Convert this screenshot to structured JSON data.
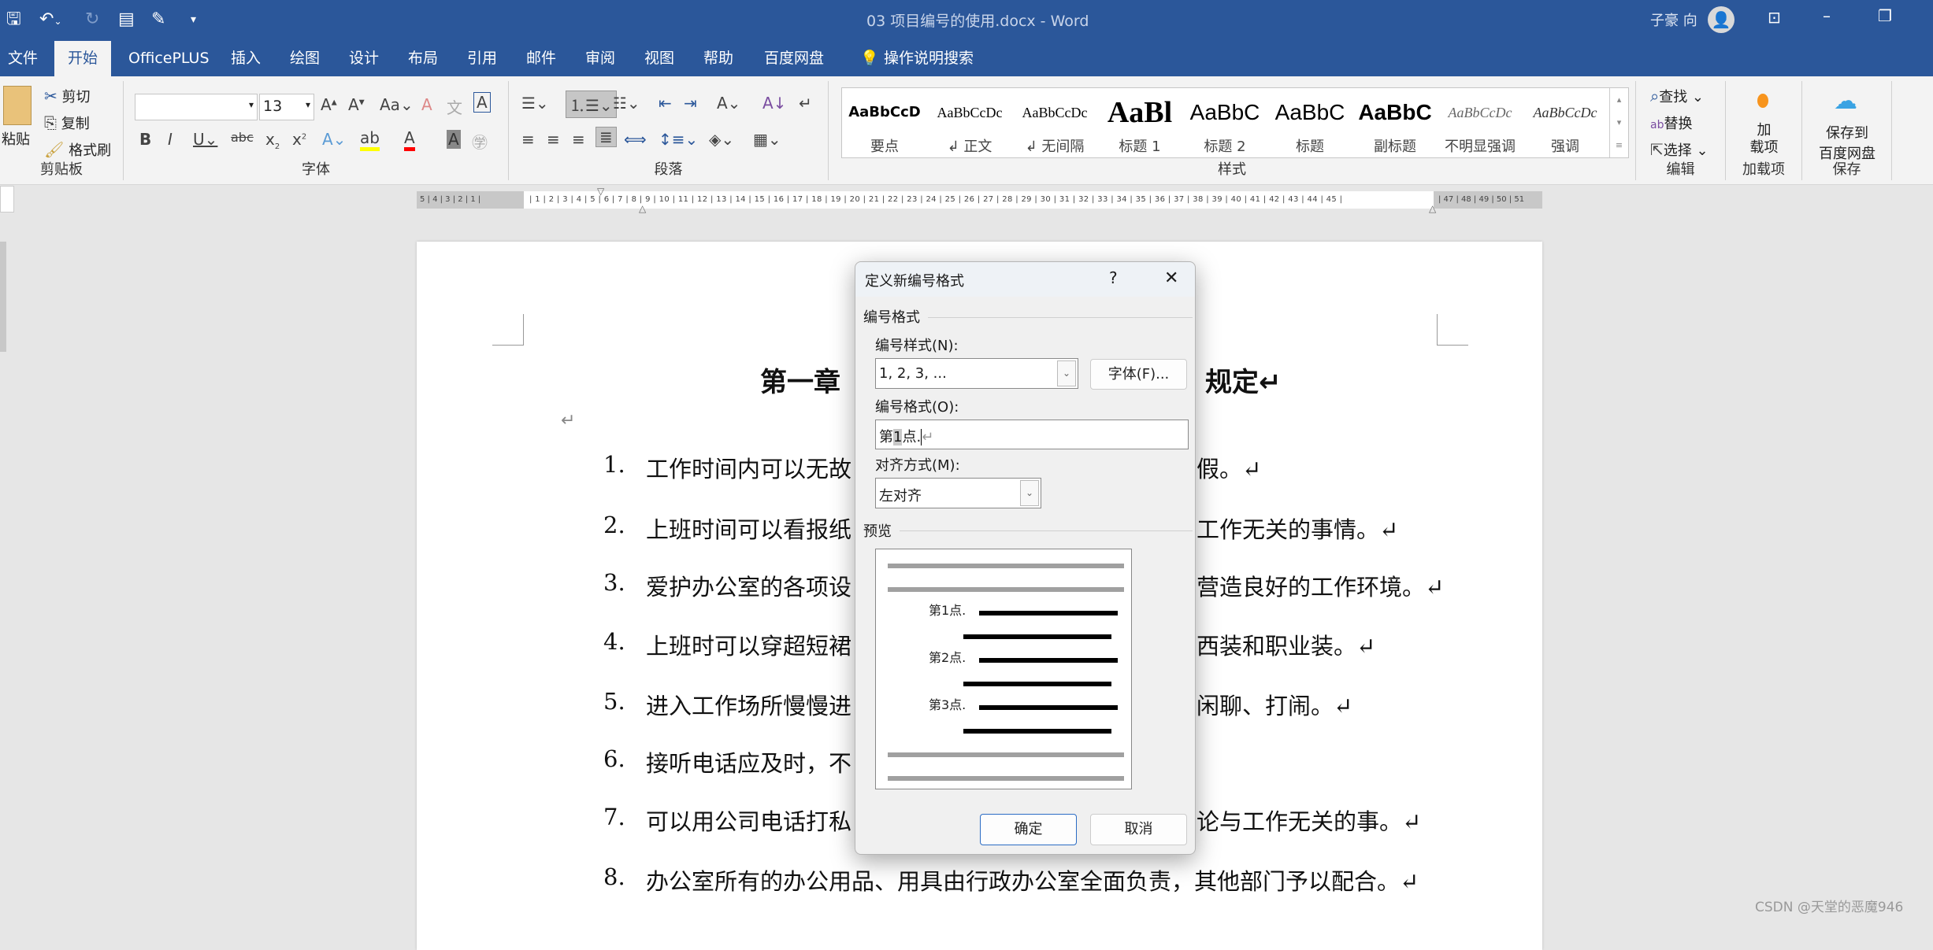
{
  "window": {
    "title": "03 项目编号的使用.docx  -  Word",
    "user": "子豪 向",
    "quick_access": [
      "save-icon",
      "undo-icon",
      "redo-icon",
      "form-icon",
      "edit-icon",
      "customize-icon"
    ]
  },
  "tabs": [
    {
      "label": "文件"
    },
    {
      "label": "开始",
      "active": true
    },
    {
      "label": "OfficePLUS"
    },
    {
      "label": "插入"
    },
    {
      "label": "绘图"
    },
    {
      "label": "设计"
    },
    {
      "label": "布局"
    },
    {
      "label": "引用"
    },
    {
      "label": "邮件"
    },
    {
      "label": "审阅"
    },
    {
      "label": "视图"
    },
    {
      "label": "帮助"
    },
    {
      "label": "百度网盘"
    },
    {
      "label": "操作说明搜索"
    }
  ],
  "ribbon": {
    "clipboard": {
      "label": "剪贴板",
      "paste": "粘贴",
      "cut": "剪切",
      "copy": "复制",
      "format_painter": "格式刷"
    },
    "font": {
      "label": "字体",
      "font_name": "",
      "font_size": "13"
    },
    "paragraph": {
      "label": "段落"
    },
    "styles": {
      "label": "样式",
      "items": [
        {
          "preview": "AaBbCcD",
          "name": "要点"
        },
        {
          "preview": "AaBbCcDc",
          "name": "↲ 正文"
        },
        {
          "preview": "AaBbCcDc",
          "name": "↲ 无间隔"
        },
        {
          "preview": "AaBl",
          "name": "标题 1"
        },
        {
          "preview": "AaBbC",
          "name": "标题 2"
        },
        {
          "preview": "AaBbC",
          "name": "标题"
        },
        {
          "preview": "AaBbC",
          "name": "副标题"
        },
        {
          "preview": "AaBbCcDc",
          "name": "不明显强调"
        },
        {
          "preview": "AaBbCcDc",
          "name": "强调"
        }
      ]
    },
    "editing": {
      "label": "编辑",
      "find": "查找",
      "replace": "替换",
      "select": "选择"
    },
    "addins": {
      "label": "加载项",
      "button": "加\n载项"
    },
    "save": {
      "label": "保存",
      "button1": "保存到",
      "button2": "百度网盘"
    }
  },
  "ruler": {
    "left": "5 | 4 | 3 | 2 | 1 |",
    "main": "| 1 | 2 | 3 | 4 | 5 | 6 | 7 | 8 | 9 | 10 | 11 | 12 | 13 | 14 | 15 | 16 | 17 | 18 | 19 | 20 | 21 | 22 | 23 | 24 | 25 | 26 | 27 | 28 | 29 | 30 | 31 | 32 | 33 | 34 | 35 | 36 | 37 | 38 | 39 | 40 | 41 | 42 | 43 | 44 | 45 |",
    "right": "| 47 | 48 | 49 | 50 | 51"
  },
  "document": {
    "title_left": "第一章",
    "title_right": "规定↵",
    "empty_para": "↵",
    "items": [
      {
        "num": "1.",
        "left": "工作时间内可以无故",
        "right": "假。↵"
      },
      {
        "num": "2.",
        "left": "上班时间可以看报纸",
        "right": "工作无关的事情。↵"
      },
      {
        "num": "3.",
        "left": "爱护办公室的各项设",
        "right": "营造良好的工作环境。↵"
      },
      {
        "num": "4.",
        "left": "上班时可以穿超短裙",
        "right": "西装和职业装。↵"
      },
      {
        "num": "5.",
        "left": "进入工作场所慢慢进",
        "right": "闲聊、打闹。↵"
      },
      {
        "num": "6.",
        "left": "接听电话应及时，不",
        "right": ""
      },
      {
        "num": "7.",
        "left": "可以用公司电话打私",
        "right": "论与工作无关的事。↵"
      },
      {
        "num": "8.",
        "left": "办公室所有的办公用品、用具由行政办公室全面负责，其他部门予以配合。↵",
        "right": ""
      }
    ]
  },
  "dialog": {
    "title": "定义新编号格式",
    "help": "?",
    "close": "✕",
    "group_label": "编号格式",
    "style_label": "编号样式(N):",
    "style_value": "1, 2, 3, ...",
    "font_button": "字体(F)...",
    "format_label": "编号格式(O):",
    "format_value_prefix": "第",
    "format_value_number": "1",
    "format_value_suffix": "点.",
    "format_mark": "↵",
    "align_label": "对齐方式(M):",
    "align_value": "左对齐",
    "preview_label": "预览",
    "preview_items": [
      "第1点.",
      "第2点.",
      "第3点."
    ],
    "ok": "确定",
    "cancel": "取消"
  },
  "watermark": "CSDN @天堂的恶魔946"
}
